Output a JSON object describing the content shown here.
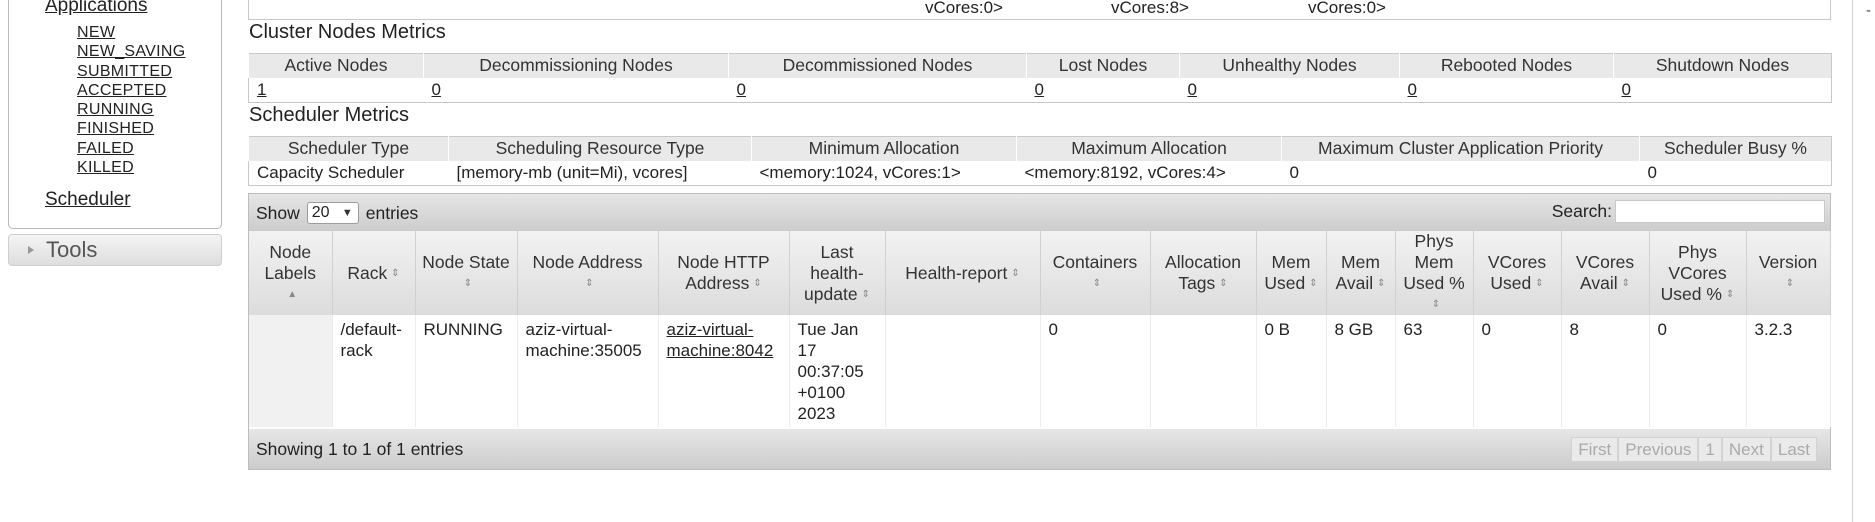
{
  "nav": {
    "applications_label": "Applications",
    "app_states": [
      "NEW",
      "NEW_SAVING",
      "SUBMITTED",
      "ACCEPTED",
      "RUNNING",
      "FINISHED",
      "FAILED",
      "KILLED"
    ],
    "scheduler_label": "Scheduler",
    "tools_label": "Tools"
  },
  "top_strip": {
    "values": [
      "vCores:0>",
      "vCores:8>",
      "vCores:0>"
    ]
  },
  "cluster_nodes_metrics": {
    "title": "Cluster Nodes Metrics",
    "headers": [
      "Active Nodes",
      "Decommissioning Nodes",
      "Decommissioned Nodes",
      "Lost Nodes",
      "Unhealthy Nodes",
      "Rebooted Nodes",
      "Shutdown Nodes"
    ],
    "values": [
      "1",
      "0",
      "0",
      "0",
      "0",
      "0",
      "0"
    ]
  },
  "scheduler_metrics": {
    "title": "Scheduler Metrics",
    "headers": [
      "Scheduler Type",
      "Scheduling Resource Type",
      "Minimum Allocation",
      "Maximum Allocation",
      "Maximum Cluster Application Priority",
      "Scheduler Busy %"
    ],
    "values": [
      "Capacity Scheduler",
      "[memory-mb (unit=Mi), vcores]",
      "<memory:1024, vCores:1>",
      "<memory:8192, vCores:4>",
      "0",
      "0"
    ]
  },
  "nodes_table": {
    "show_label": "Show",
    "entries_label": "entries",
    "page_size": "20",
    "search_label": "Search:",
    "search_value": "",
    "headers": [
      "Node Labels",
      "Rack",
      "Node State",
      "Node Address",
      "Node HTTP Address",
      "Last health-update",
      "Health-report",
      "Containers",
      "Allocation Tags",
      "Mem Used",
      "Mem Avail",
      "Phys Mem Used %",
      "VCores Used",
      "VCores Avail",
      "Phys VCores Used %",
      "Version"
    ],
    "rows": [
      {
        "node_labels": "",
        "rack": "/default-rack",
        "node_state": "RUNNING",
        "node_address": "aziz-virtual-machine:35005",
        "node_http_address": "aziz-virtual-machine:8042",
        "last_health_update": "Tue Jan 17 00:37:05 +0100 2023",
        "health_report": "",
        "containers": "0",
        "allocation_tags": "",
        "mem_used": "0 B",
        "mem_avail": "8 GB",
        "phys_mem_used_pct": "63",
        "vcores_used": "0",
        "vcores_avail": "8",
        "phys_vcores_used_pct": "0",
        "version": "3.2.3"
      }
    ],
    "info": "Showing 1 to 1 of 1 entries",
    "pagination": {
      "first": "First",
      "previous": "Previous",
      "current": "1",
      "next": "Next",
      "last": "Last"
    }
  },
  "right_mark": "-"
}
